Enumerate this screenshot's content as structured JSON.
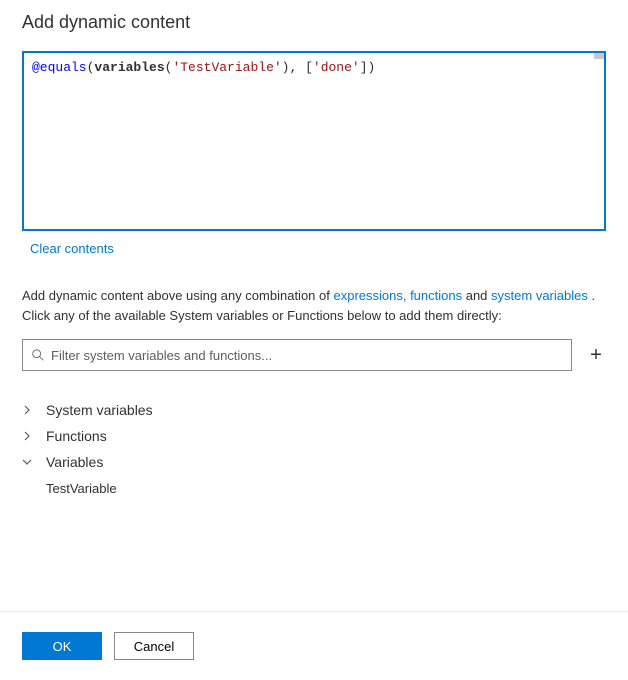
{
  "title": "Add dynamic content",
  "editor": {
    "tokens": [
      {
        "t": "@equals",
        "cls": "tok-at"
      },
      {
        "t": "(",
        "cls": "tok-paren"
      },
      {
        "t": "variables",
        "cls": "tok-var"
      },
      {
        "t": "(",
        "cls": "tok-paren"
      },
      {
        "t": "'TestVariable'",
        "cls": "tok-str"
      },
      {
        "t": ")",
        "cls": "tok-paren"
      },
      {
        "t": ", ",
        "cls": "tok-comma"
      },
      {
        "t": "[",
        "cls": "tok-paren"
      },
      {
        "t": "'done'",
        "cls": "tok-str"
      },
      {
        "t": "]",
        "cls": "tok-paren"
      },
      {
        "t": ")",
        "cls": "tok-paren"
      }
    ]
  },
  "clear_label": "Clear contents",
  "help": {
    "prefix": "Add dynamic content above using any combination of ",
    "link1": "expressions, functions",
    "mid": " and ",
    "link2": "system variables",
    "suffix1": " . Click any of the available System variables or Functions below to add them directly:"
  },
  "filter": {
    "placeholder": "Filter system variables and functions..."
  },
  "sections": {
    "system_variables": {
      "label": "System variables",
      "expanded": false
    },
    "functions": {
      "label": "Functions",
      "expanded": false
    },
    "variables": {
      "label": "Variables",
      "expanded": true,
      "items": [
        "TestVariable"
      ]
    }
  },
  "footer": {
    "ok": "OK",
    "cancel": "Cancel"
  }
}
